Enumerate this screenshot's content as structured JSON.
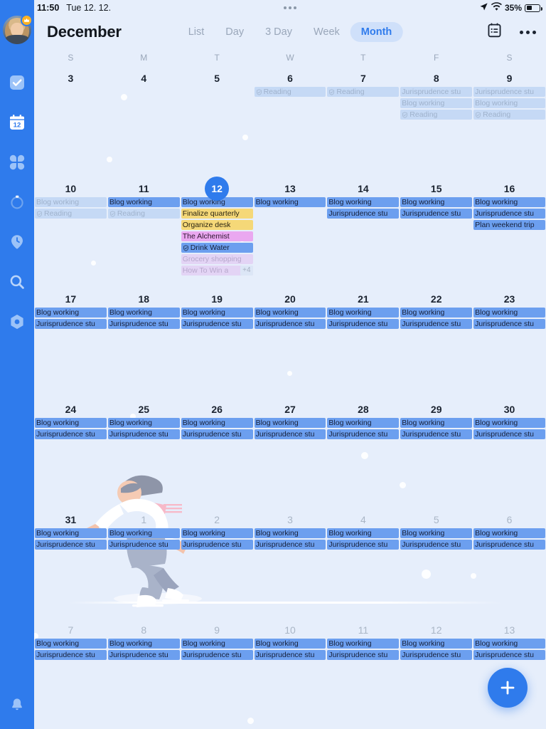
{
  "status_bar": {
    "time": "11:50",
    "date": "Tue 12. 12.",
    "battery_percent": "35%",
    "icons": [
      "location-arrow-icon",
      "wifi-icon",
      "battery-icon"
    ]
  },
  "header": {
    "title": "December",
    "tabs": [
      {
        "label": "List",
        "active": false
      },
      {
        "label": "Day",
        "active": false
      },
      {
        "label": "3 Day",
        "active": false
      },
      {
        "label": "Week",
        "active": false
      },
      {
        "label": "Month",
        "active": true
      }
    ],
    "agenda_icon": "agenda-clipboard-icon",
    "more_icon": "more-horizontal-icon"
  },
  "sidebar": {
    "avatar": {
      "name": "user-avatar",
      "badge": "crown-badge"
    },
    "items": [
      {
        "name": "tasks-icon",
        "active": false
      },
      {
        "name": "calendar-12-icon",
        "active": true
      },
      {
        "name": "matrix-grid-icon",
        "active": false
      },
      {
        "name": "pomodoro-timer-icon",
        "active": false
      },
      {
        "name": "habit-clock-icon",
        "active": false
      },
      {
        "name": "search-icon",
        "active": false
      },
      {
        "name": "settings-hex-icon",
        "active": false
      }
    ],
    "bottom": {
      "name": "notification-bell-icon"
    }
  },
  "calendar": {
    "weekdays": [
      "S",
      "M",
      "T",
      "W",
      "T",
      "F",
      "S"
    ],
    "colors": {
      "accent": "#2f7bec",
      "event_blue": "#6c9fef",
      "event_blue_pale": "#c5d9f5",
      "event_yellow": "#f5d878",
      "event_pink": "#eaa8f0",
      "event_purple_pale": "#e3d4f5",
      "background": "#e6eefb"
    },
    "days": [
      {
        "num": "3",
        "month": "current",
        "today": false,
        "events": []
      },
      {
        "num": "4",
        "month": "current",
        "today": false,
        "events": []
      },
      {
        "num": "5",
        "month": "current",
        "today": false,
        "events": []
      },
      {
        "num": "6",
        "month": "current",
        "today": false,
        "events": [
          {
            "title": "Reading",
            "style": "blue-pale",
            "icon": "check-shield-icon"
          }
        ]
      },
      {
        "num": "7",
        "month": "current",
        "today": false,
        "events": [
          {
            "title": "Reading",
            "style": "blue-pale",
            "icon": "check-shield-icon"
          }
        ]
      },
      {
        "num": "8",
        "month": "current",
        "today": false,
        "events": [
          {
            "title": "Jurisprudence stu",
            "style": "blue-pale",
            "icon": ""
          },
          {
            "title": "Blog working",
            "style": "blue-pale",
            "icon": ""
          },
          {
            "title": "Reading",
            "style": "blue-pale",
            "icon": "check-shield-icon"
          }
        ]
      },
      {
        "num": "9",
        "month": "current",
        "today": false,
        "events": [
          {
            "title": "Jurisprudence stu",
            "style": "blue-pale",
            "icon": ""
          },
          {
            "title": "Blog working",
            "style": "blue-pale",
            "icon": ""
          },
          {
            "title": "Reading",
            "style": "blue-pale",
            "icon": "check-shield-icon"
          }
        ]
      },
      {
        "num": "10",
        "month": "current",
        "today": false,
        "events": [
          {
            "title": "Blog working",
            "style": "blue-pale",
            "icon": ""
          },
          {
            "title": "Reading",
            "style": "blue-pale",
            "icon": "check-shield-icon"
          }
        ]
      },
      {
        "num": "11",
        "month": "current",
        "today": false,
        "events": [
          {
            "title": "Blog working",
            "style": "blue",
            "icon": ""
          },
          {
            "title": "Reading",
            "style": "blue-pale",
            "icon": "check-shield-icon"
          }
        ]
      },
      {
        "num": "12",
        "month": "current",
        "today": true,
        "events": [
          {
            "title": "Blog working",
            "style": "blue",
            "icon": ""
          },
          {
            "title": "Finalize quarterly",
            "style": "yellow",
            "icon": ""
          },
          {
            "title": "Organize desk",
            "style": "yellow",
            "icon": ""
          },
          {
            "title": "The Alchemist",
            "style": "pink",
            "icon": ""
          },
          {
            "title": "Drink Water",
            "style": "blue",
            "icon": "check-shield-icon"
          },
          {
            "title": "Grocery shopping",
            "style": "purple-pale",
            "icon": ""
          },
          {
            "title": "How To Win a",
            "style": "purple-pale",
            "icon": "",
            "overflow": "+4"
          }
        ]
      },
      {
        "num": "13",
        "month": "current",
        "today": false,
        "events": [
          {
            "title": "Blog working",
            "style": "blue",
            "icon": ""
          }
        ]
      },
      {
        "num": "14",
        "month": "current",
        "today": false,
        "events": [
          {
            "title": "Blog working",
            "style": "blue",
            "icon": ""
          },
          {
            "title": "Jurisprudence stu",
            "style": "blue",
            "icon": ""
          }
        ]
      },
      {
        "num": "15",
        "month": "current",
        "today": false,
        "events": [
          {
            "title": "Blog working",
            "style": "blue",
            "icon": ""
          },
          {
            "title": "Jurisprudence stu",
            "style": "blue",
            "icon": ""
          }
        ]
      },
      {
        "num": "16",
        "month": "current",
        "today": false,
        "events": [
          {
            "title": "Blog working",
            "style": "blue",
            "icon": ""
          },
          {
            "title": "Jurisprudence stu",
            "style": "blue",
            "icon": ""
          },
          {
            "title": "Plan weekend trip",
            "style": "blue",
            "icon": ""
          }
        ]
      },
      {
        "num": "17",
        "month": "current",
        "today": false,
        "events": [
          {
            "title": "Blog working",
            "style": "blue",
            "icon": ""
          },
          {
            "title": "Jurisprudence stu",
            "style": "blue",
            "icon": ""
          }
        ]
      },
      {
        "num": "18",
        "month": "current",
        "today": false,
        "events": [
          {
            "title": "Blog working",
            "style": "blue",
            "icon": ""
          },
          {
            "title": "Jurisprudence stu",
            "style": "blue",
            "icon": ""
          }
        ]
      },
      {
        "num": "19",
        "month": "current",
        "today": false,
        "events": [
          {
            "title": "Blog working",
            "style": "blue",
            "icon": ""
          },
          {
            "title": "Jurisprudence stu",
            "style": "blue",
            "icon": ""
          }
        ]
      },
      {
        "num": "20",
        "month": "current",
        "today": false,
        "events": [
          {
            "title": "Blog working",
            "style": "blue",
            "icon": ""
          },
          {
            "title": "Jurisprudence stu",
            "style": "blue",
            "icon": ""
          }
        ]
      },
      {
        "num": "21",
        "month": "current",
        "today": false,
        "events": [
          {
            "title": "Blog working",
            "style": "blue",
            "icon": ""
          },
          {
            "title": "Jurisprudence stu",
            "style": "blue",
            "icon": ""
          }
        ]
      },
      {
        "num": "22",
        "month": "current",
        "today": false,
        "events": [
          {
            "title": "Blog working",
            "style": "blue",
            "icon": ""
          },
          {
            "title": "Jurisprudence stu",
            "style": "blue",
            "icon": ""
          }
        ]
      },
      {
        "num": "23",
        "month": "current",
        "today": false,
        "events": [
          {
            "title": "Blog working",
            "style": "blue",
            "icon": ""
          },
          {
            "title": "Jurisprudence stu",
            "style": "blue",
            "icon": ""
          }
        ]
      },
      {
        "num": "24",
        "month": "current",
        "today": false,
        "events": [
          {
            "title": "Blog working",
            "style": "blue",
            "icon": ""
          },
          {
            "title": "Jurisprudence stu",
            "style": "blue",
            "icon": ""
          }
        ]
      },
      {
        "num": "25",
        "month": "current",
        "today": false,
        "events": [
          {
            "title": "Blog working",
            "style": "blue",
            "icon": ""
          },
          {
            "title": "Jurisprudence stu",
            "style": "blue",
            "icon": ""
          }
        ]
      },
      {
        "num": "26",
        "month": "current",
        "today": false,
        "events": [
          {
            "title": "Blog working",
            "style": "blue",
            "icon": ""
          },
          {
            "title": "Jurisprudence stu",
            "style": "blue",
            "icon": ""
          }
        ]
      },
      {
        "num": "27",
        "month": "current",
        "today": false,
        "events": [
          {
            "title": "Blog working",
            "style": "blue",
            "icon": ""
          },
          {
            "title": "Jurisprudence stu",
            "style": "blue",
            "icon": ""
          }
        ]
      },
      {
        "num": "28",
        "month": "current",
        "today": false,
        "events": [
          {
            "title": "Blog working",
            "style": "blue",
            "icon": ""
          },
          {
            "title": "Jurisprudence stu",
            "style": "blue",
            "icon": ""
          }
        ]
      },
      {
        "num": "29",
        "month": "current",
        "today": false,
        "events": [
          {
            "title": "Blog working",
            "style": "blue",
            "icon": ""
          },
          {
            "title": "Jurisprudence stu",
            "style": "blue",
            "icon": ""
          }
        ]
      },
      {
        "num": "30",
        "month": "current",
        "today": false,
        "events": [
          {
            "title": "Blog working",
            "style": "blue",
            "icon": ""
          },
          {
            "title": "Jurisprudence stu",
            "style": "blue",
            "icon": ""
          }
        ]
      },
      {
        "num": "31",
        "month": "current",
        "today": false,
        "events": [
          {
            "title": "Blog working",
            "style": "blue",
            "icon": ""
          },
          {
            "title": "Jurisprudence stu",
            "style": "blue",
            "icon": ""
          }
        ]
      },
      {
        "num": "1",
        "month": "next",
        "today": false,
        "events": [
          {
            "title": "Blog working",
            "style": "blue",
            "icon": ""
          },
          {
            "title": "Jurisprudence stu",
            "style": "blue",
            "icon": ""
          }
        ]
      },
      {
        "num": "2",
        "month": "next",
        "today": false,
        "events": [
          {
            "title": "Blog working",
            "style": "blue",
            "icon": ""
          },
          {
            "title": "Jurisprudence stu",
            "style": "blue",
            "icon": ""
          }
        ]
      },
      {
        "num": "3",
        "month": "next",
        "today": false,
        "events": [
          {
            "title": "Blog working",
            "style": "blue",
            "icon": ""
          },
          {
            "title": "Jurisprudence stu",
            "style": "blue",
            "icon": ""
          }
        ]
      },
      {
        "num": "4",
        "month": "next",
        "today": false,
        "events": [
          {
            "title": "Blog working",
            "style": "blue",
            "icon": ""
          },
          {
            "title": "Jurisprudence stu",
            "style": "blue",
            "icon": ""
          }
        ]
      },
      {
        "num": "5",
        "month": "next",
        "today": false,
        "events": [
          {
            "title": "Blog working",
            "style": "blue",
            "icon": ""
          },
          {
            "title": "Jurisprudence stu",
            "style": "blue",
            "icon": ""
          }
        ]
      },
      {
        "num": "6",
        "month": "next",
        "today": false,
        "events": [
          {
            "title": "Blog working",
            "style": "blue",
            "icon": ""
          },
          {
            "title": "Jurisprudence stu",
            "style": "blue",
            "icon": ""
          }
        ]
      },
      {
        "num": "7",
        "month": "next",
        "today": false,
        "events": [
          {
            "title": "Blog working",
            "style": "blue",
            "icon": ""
          },
          {
            "title": "Jurisprudence stu",
            "style": "blue",
            "icon": ""
          }
        ]
      },
      {
        "num": "8",
        "month": "next",
        "today": false,
        "events": [
          {
            "title": "Blog working",
            "style": "blue",
            "icon": ""
          },
          {
            "title": "Jurisprudence stu",
            "style": "blue",
            "icon": ""
          }
        ]
      },
      {
        "num": "9",
        "month": "next",
        "today": false,
        "events": [
          {
            "title": "Blog working",
            "style": "blue",
            "icon": ""
          },
          {
            "title": "Jurisprudence stu",
            "style": "blue",
            "icon": ""
          }
        ]
      },
      {
        "num": "10",
        "month": "next",
        "today": false,
        "events": [
          {
            "title": "Blog working",
            "style": "blue",
            "icon": ""
          },
          {
            "title": "Jurisprudence stu",
            "style": "blue",
            "icon": ""
          }
        ]
      },
      {
        "num": "11",
        "month": "next",
        "today": false,
        "events": [
          {
            "title": "Blog working",
            "style": "blue",
            "icon": ""
          },
          {
            "title": "Jurisprudence stu",
            "style": "blue",
            "icon": ""
          }
        ]
      },
      {
        "num": "12",
        "month": "next",
        "today": false,
        "events": [
          {
            "title": "Blog working",
            "style": "blue",
            "icon": ""
          },
          {
            "title": "Jurisprudence stu",
            "style": "blue",
            "icon": ""
          }
        ]
      },
      {
        "num": "13",
        "month": "next",
        "today": false,
        "events": [
          {
            "title": "Blog working",
            "style": "blue",
            "icon": ""
          },
          {
            "title": "Jurisprudence stu",
            "style": "blue",
            "icon": ""
          }
        ]
      }
    ]
  },
  "fab": {
    "label": "+",
    "name": "add-event-button"
  },
  "decoration": {
    "illustration": "ice-skater-illustration"
  }
}
